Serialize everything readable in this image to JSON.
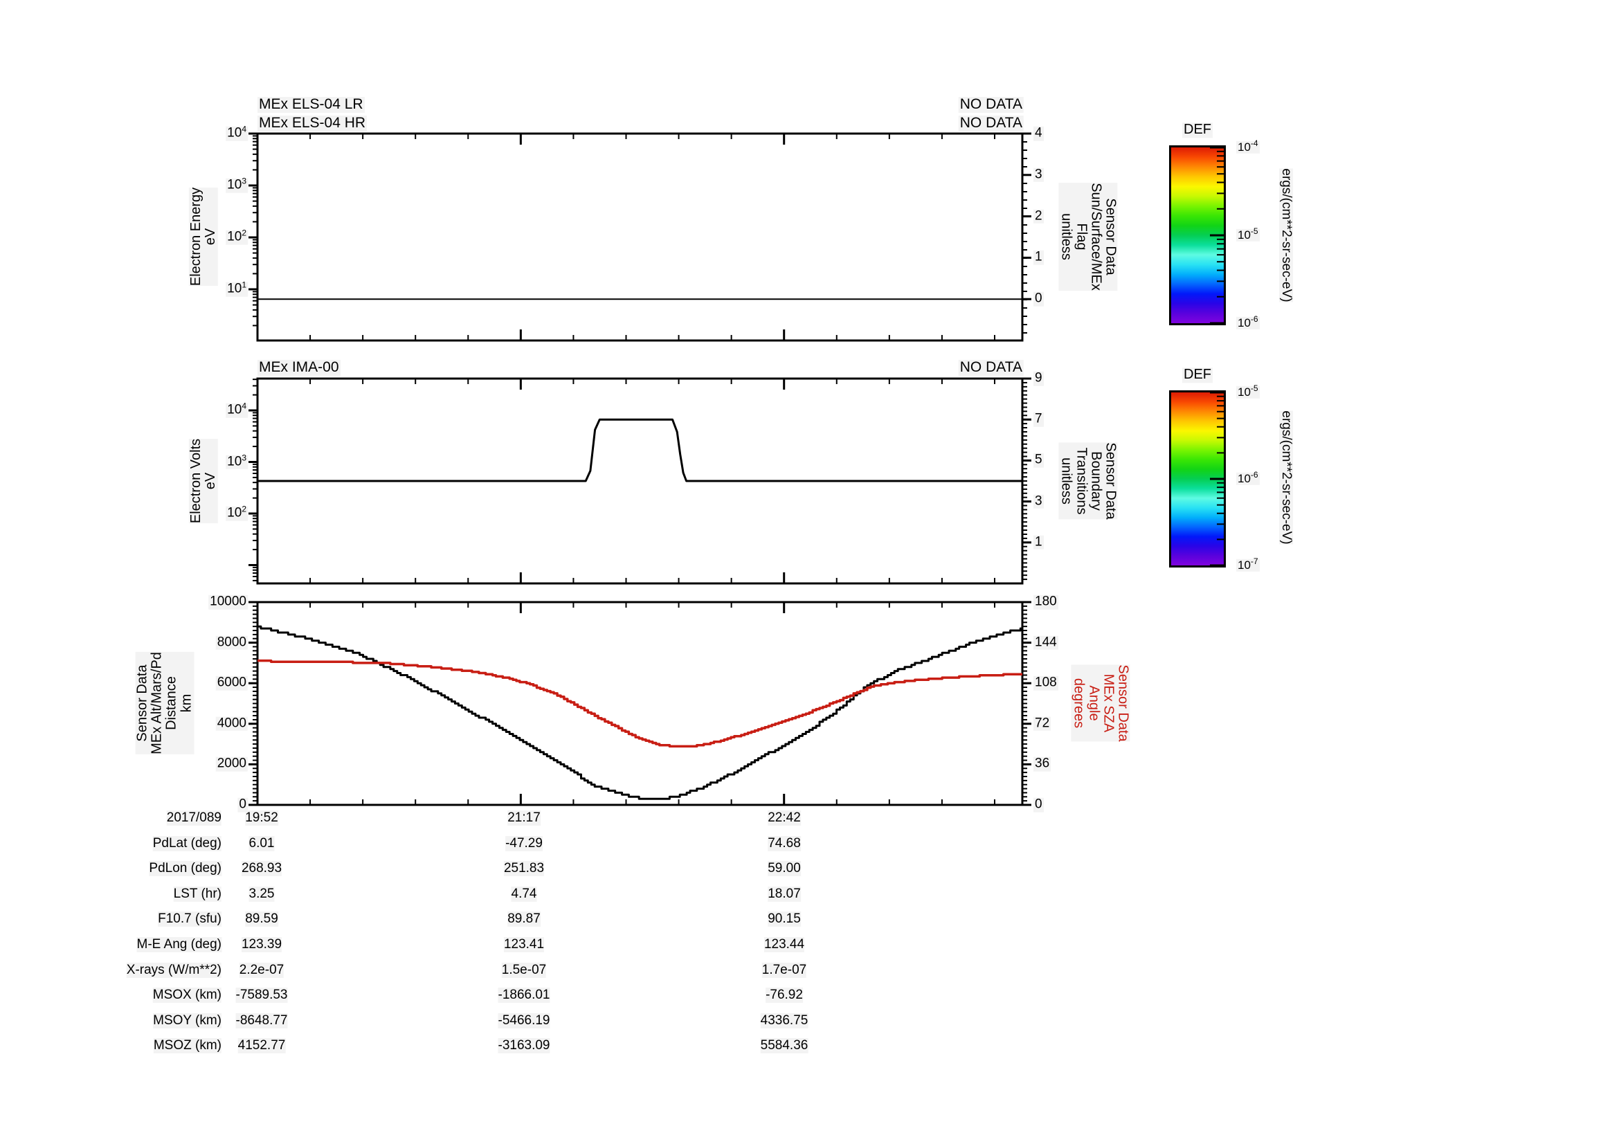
{
  "page": {
    "background": "#ffffff",
    "text_color": "#000000",
    "accent_red": "#c81e14"
  },
  "panels": [
    {
      "key": "els",
      "titles": [
        "MEx ELS-04 LR",
        "MEx ELS-04 HR"
      ],
      "no_data": [
        "NO DATA",
        "NO DATA"
      ],
      "left_axis": {
        "title_lines": [
          "Electron Energy",
          "eV",
          "",
          ""
        ],
        "scale": "log",
        "tick_exponents": [
          4,
          3,
          2,
          1
        ],
        "range": [
          1,
          10000
        ]
      },
      "right_axis": {
        "title_lines": [
          "Sensor Data",
          "Sun/Surface/MEx",
          "Flag",
          "unitless"
        ],
        "tick_values": [
          4,
          3,
          2,
          1,
          0
        ],
        "range": [
          -1,
          4
        ]
      }
    },
    {
      "key": "ima",
      "titles": [
        "MEx IMA-00",
        ""
      ],
      "no_data": [
        "NO DATA",
        ""
      ],
      "left_axis": {
        "title_lines": [
          "Electron Volts",
          "eV",
          "",
          ""
        ],
        "scale": "log",
        "tick_exponents": [
          4,
          3,
          2
        ],
        "range": [
          4.4,
          41000
        ]
      },
      "right_axis": {
        "title_lines": [
          "Sensor Data",
          "Boundary",
          "Transitions",
          "unitless"
        ],
        "tick_values": [
          9,
          7,
          5,
          3,
          1
        ],
        "range": [
          -1,
          9
        ]
      }
    },
    {
      "key": "ephemeris",
      "titles": [
        "",
        ""
      ],
      "no_data": [
        "",
        ""
      ],
      "left_axis": {
        "title_lines": [
          "Sensor Data",
          "MEx Alt/Mars/Pd",
          "Distance",
          "km"
        ],
        "scale": "linear",
        "tick_values": [
          10000,
          8000,
          6000,
          4000,
          2000,
          0
        ],
        "range": [
          0,
          10000
        ]
      },
      "right_axis": {
        "title_lines": [
          "Sensor Data",
          "MEx SZA",
          "Angle",
          "degrees"
        ],
        "tick_values": [
          180,
          144,
          108,
          72,
          36,
          0
        ],
        "range": [
          0,
          180
        ],
        "color": "#c81e14"
      }
    }
  ],
  "colorbars": [
    {
      "title": "DEF",
      "unit": "ergs/(cm**2-sr-sec-eV)",
      "tick_exponents": [
        -4,
        -5,
        -6
      ],
      "gradient": [
        "#dd1c04",
        "#f94902",
        "#fe8903",
        "#fec701",
        "#fbf700",
        "#c8f902",
        "#7af401",
        "#3ae604",
        "#12d415",
        "#05ce53",
        "#0bdf9b",
        "#5efbe2",
        "#29e2f3",
        "#02b0fb",
        "#0366fe",
        "#0218f9",
        "#2a04e7",
        "#5a02dd",
        "#8004de"
      ]
    },
    {
      "title": "DEF",
      "unit": "ergs/(cm**2-sr-sec-eV)",
      "tick_exponents": [
        -5,
        -6,
        -7
      ],
      "gradient": [
        "#dd1c04",
        "#f94902",
        "#fe8903",
        "#fec701",
        "#fbf700",
        "#c8f902",
        "#7af401",
        "#3ae604",
        "#12d415",
        "#05ce53",
        "#0bdf9b",
        "#5efbe2",
        "#29e2f3",
        "#02b0fb",
        "#0366fe",
        "#0218f9",
        "#2a04e7",
        "#5a02dd",
        "#8004de"
      ]
    }
  ],
  "table": {
    "date_label": "2017/089",
    "time_labels": [
      "19:52",
      "21:17",
      "22:42"
    ],
    "rows": [
      {
        "label": "PdLat (deg)",
        "values": [
          "6.01",
          "-47.29",
          "74.68"
        ]
      },
      {
        "label": "PdLon (deg)",
        "values": [
          "268.93",
          "251.83",
          "59.00"
        ]
      },
      {
        "label": "LST (hr)",
        "values": [
          "3.25",
          "4.74",
          "18.07"
        ]
      },
      {
        "label": "F10.7 (sfu)",
        "values": [
          "89.59",
          "89.87",
          "90.15"
        ]
      },
      {
        "label": "M-E Ang (deg)",
        "values": [
          "123.39",
          "123.41",
          "123.44"
        ]
      },
      {
        "label": "X-rays (W/m**2)",
        "values": [
          "2.2e-07",
          "1.5e-07",
          "1.7e-07"
        ]
      },
      {
        "label": "MSOX (km)",
        "values": [
          "-7589.53",
          "-1866.01",
          "-76.92"
        ]
      },
      {
        "label": "MSOY (km)",
        "values": [
          "-8648.77",
          "-5466.19",
          "4336.75"
        ]
      },
      {
        "label": "MSOZ (km)",
        "values": [
          "4152.77",
          "-3163.09",
          "5584.36"
        ]
      }
    ]
  },
  "chart_data": [
    {
      "type": "line",
      "title": "MEx ELS-04 LR / MEx ELS-04 HR (NO DATA)",
      "x_axis": {
        "label": "time",
        "start": "19:52",
        "end": "23:59",
        "major_tick_labels": [
          "19:52",
          "21:17",
          "22:42"
        ],
        "minutes_range": [
          0,
          247
        ]
      },
      "left_axis": {
        "label": "Electron Energy eV",
        "scale": "log",
        "range": [
          1,
          10000
        ]
      },
      "right_axis": {
        "label": "Sensor Data Sun/Surface/MEx Flag unitless",
        "range": [
          -1,
          4
        ]
      },
      "series": [
        {
          "name": "Sun/Surface/MEx Flag",
          "axis": "right",
          "color": "#000000",
          "points_t_v": [
            [
              0,
              0
            ],
            [
              247,
              0
            ]
          ]
        }
      ]
    },
    {
      "type": "line",
      "title": "MEx IMA-00 (NO DATA)",
      "x_axis": {
        "minutes_range": [
          0,
          247
        ]
      },
      "left_axis": {
        "label": "Electron Volts eV",
        "scale": "log",
        "range": [
          4.4,
          41000
        ]
      },
      "right_axis": {
        "label": "Sensor Data Boundary Transitions unitless",
        "range": [
          -1,
          9
        ]
      },
      "series": [
        {
          "name": "Boundary Transitions",
          "axis": "right",
          "color": "#000000",
          "points_t_v": [
            [
              0,
              4
            ],
            [
              106,
              4
            ],
            [
              107.5,
              4.5
            ],
            [
              109,
              6.5
            ],
            [
              110.5,
              7
            ],
            [
              134,
              7
            ],
            [
              135.5,
              6.4
            ],
            [
              136.5,
              5.3
            ],
            [
              137.5,
              4.4
            ],
            [
              138.5,
              4
            ],
            [
              247,
              4
            ]
          ]
        }
      ]
    },
    {
      "type": "line",
      "title": "Ephemeris",
      "x_axis": {
        "minutes_range": [
          0,
          247
        ]
      },
      "left_axis": {
        "label": "Sensor Data MEx Alt/Mars/Pd Distance km",
        "range": [
          0,
          10000
        ]
      },
      "right_axis": {
        "label": "Sensor Data MEx SZA Angle degrees",
        "range": [
          0,
          180
        ]
      },
      "series": [
        {
          "name": "MEx Alt/Mars/Pd Distance",
          "axis": "left",
          "color": "#000000",
          "step_quantum": 100,
          "points_t_v": [
            [
              0,
              8780
            ],
            [
              17.4,
              8150
            ],
            [
              33,
              7400
            ],
            [
              46.5,
              6420
            ],
            [
              57.6,
              5520
            ],
            [
              68.8,
              4580
            ],
            [
              80,
              3620
            ],
            [
              91.1,
              2620
            ],
            [
              96.3,
              2150
            ],
            [
              102.3,
              1600
            ],
            [
              106.8,
              1060
            ],
            [
              113.5,
              690
            ],
            [
              119,
              480
            ],
            [
              123.5,
              300
            ],
            [
              129.1,
              300
            ],
            [
              134.7,
              380
            ],
            [
              144.8,
              950
            ],
            [
              153.7,
              1600
            ],
            [
              162.6,
              2350
            ],
            [
              173.8,
              3300
            ],
            [
              185,
              4400
            ],
            [
              196.8,
              5900
            ],
            [
              207.3,
              6700
            ],
            [
              218.5,
              7300
            ],
            [
              229.6,
              7950
            ],
            [
              238.6,
              8400
            ],
            [
              246.9,
              8680
            ]
          ]
        },
        {
          "name": "MEx SZA Angle",
          "axis": "right",
          "color": "#c81e14",
          "step_quantum": 1,
          "points_t_v": [
            [
              0,
              127.6
            ],
            [
              24,
              127
            ],
            [
              42,
              125.5
            ],
            [
              57.6,
              122
            ],
            [
              68.8,
              118.5
            ],
            [
              80,
              113
            ],
            [
              86.7,
              108
            ],
            [
              95.6,
              99
            ],
            [
              102.3,
              89
            ],
            [
              106.8,
              82
            ],
            [
              112.4,
              74
            ],
            [
              118,
              66
            ],
            [
              123.5,
              58.5
            ],
            [
              129.1,
              53.5
            ],
            [
              134.7,
              51.8
            ],
            [
              141.4,
              52.5
            ],
            [
              148.1,
              56
            ],
            [
              155.9,
              62
            ],
            [
              164.9,
              70
            ],
            [
              173.8,
              78
            ],
            [
              182.7,
              87
            ],
            [
              189.4,
              95
            ],
            [
              199,
              106
            ],
            [
              209.5,
              110
            ],
            [
              223,
              113
            ],
            [
              236.4,
              115
            ],
            [
              246.9,
              116.5
            ]
          ]
        }
      ]
    }
  ]
}
